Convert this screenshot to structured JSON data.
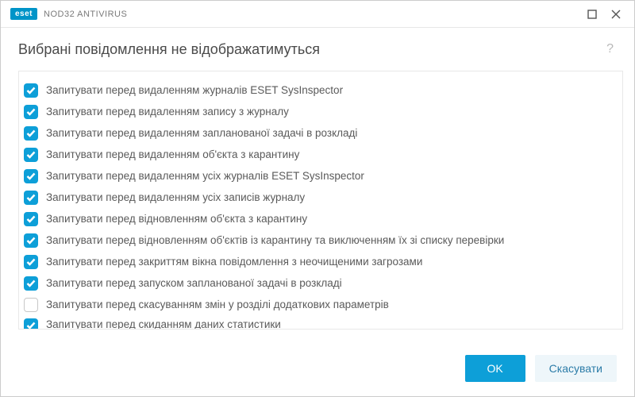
{
  "titlebar": {
    "brand_badge": "eset",
    "brand_text": "NOD32 ANTIVIRUS"
  },
  "header": {
    "title": "Вибрані повідомлення не відображатимуться",
    "help": "?"
  },
  "list": {
    "items": [
      {
        "checked": true,
        "label": "Запитувати перед видаленням журналів ESET SysInspector"
      },
      {
        "checked": true,
        "label": "Запитувати перед видаленням запису з журналу"
      },
      {
        "checked": true,
        "label": "Запитувати перед видаленням запланованої задачі в розкладі"
      },
      {
        "checked": true,
        "label": "Запитувати перед видаленням об'єкта з карантину"
      },
      {
        "checked": true,
        "label": "Запитувати перед видаленням усіх журналів ESET SysInspector"
      },
      {
        "checked": true,
        "label": "Запитувати перед видаленням усіх записів журналу"
      },
      {
        "checked": true,
        "label": "Запитувати перед відновленням об'єкта з карантину"
      },
      {
        "checked": true,
        "label": "Запитувати перед відновленням об'єктів із карантину та виключенням їх зі списку перевірки"
      },
      {
        "checked": true,
        "label": "Запитувати перед закриттям вікна повідомлення з неочищеними загрозами"
      },
      {
        "checked": true,
        "label": "Запитувати перед запуском запланованої задачі в розкладі"
      },
      {
        "checked": false,
        "label": "Запитувати перед скасуванням змін у розділі додаткових параметрів"
      },
      {
        "checked": true,
        "label": "Запитувати перед скиданням даних статистики"
      }
    ]
  },
  "footer": {
    "ok": "OK",
    "cancel": "Скасувати"
  }
}
